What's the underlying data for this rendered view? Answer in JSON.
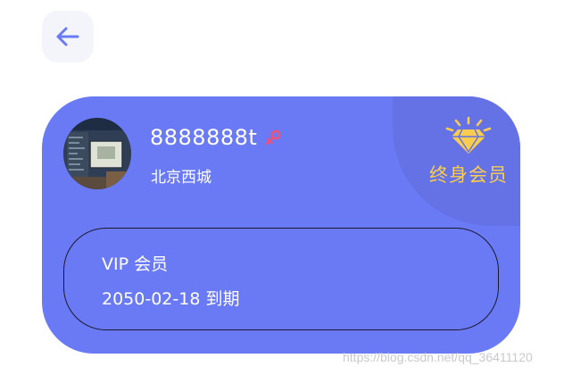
{
  "nav": {
    "back_icon": "arrow-left-icon"
  },
  "profile": {
    "username": "8888888t",
    "tag_icon": "gender-tag-icon",
    "location": "北京西城",
    "avatar": "avatar-image"
  },
  "badge": {
    "icon": "diamond-icon",
    "label": "终身会员"
  },
  "membership": {
    "title": "VIP 会员",
    "expiry": "2050-02-18 到期"
  },
  "watermark": "https://blog.csdn.net/qq_36411120",
  "colors": {
    "card": "#6a7af5",
    "card_corner": "#6472e6",
    "gold": "#f7cc4f",
    "back_button_bg": "#f4f5fb",
    "back_arrow": "#6a7af5",
    "tag": "#f0507a"
  }
}
